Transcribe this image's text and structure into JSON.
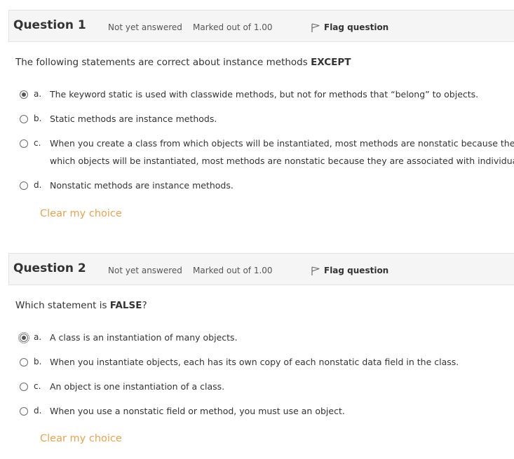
{
  "questions": [
    {
      "title": "Question 1",
      "state": "Not yet answered",
      "grade": "Marked out of 1.00",
      "flag_label": "Flag question",
      "text_before": "The following statements are correct about instance methods ",
      "text_bold": "EXCEPT",
      "text_after": "",
      "answers": [
        {
          "letter": "a.",
          "text": "The keyword static is used with classwide methods, but not for methods that “belong” to objects.",
          "checked": true
        },
        {
          "letter": "b.",
          "text": "Static methods are instance methods.",
          "checked": false
        },
        {
          "letter": "c.",
          "line1": "When you create a class from which objects will be instantiated, most methods are nonstatic because they are",
          "line2": "which objects will be instantiated, most methods are nonstatic because they are associated with individual ob",
          "checked": false
        },
        {
          "letter": "d.",
          "text": "Nonstatic methods are instance methods.",
          "checked": false
        }
      ],
      "clear_label": "Clear my choice"
    },
    {
      "title": "Question 2",
      "state": "Not yet answered",
      "grade": "Marked out of 1.00",
      "flag_label": "Flag question",
      "text_before": "Which statement is ",
      "text_bold": "FALSE",
      "text_after": "?",
      "answers": [
        {
          "letter": "a.",
          "text": "A class is an instantiation of many objects.",
          "checked": true
        },
        {
          "letter": "b.",
          "text": "When you instantiate objects, each has its own copy of each nonstatic data field in the class.",
          "checked": false
        },
        {
          "letter": "c.",
          "text": "An object is one instantiation of a class.",
          "checked": false
        },
        {
          "letter": "d.",
          "text": "When you use a nonstatic field or method, you must use an object.",
          "checked": false
        }
      ],
      "clear_label": "Clear my choice"
    }
  ],
  "colors": {
    "header_bg": "#f5f5f5",
    "clear_link": "#e8a24b",
    "text": "#333333"
  },
  "icons": {
    "flag": "flag-outline-icon"
  }
}
